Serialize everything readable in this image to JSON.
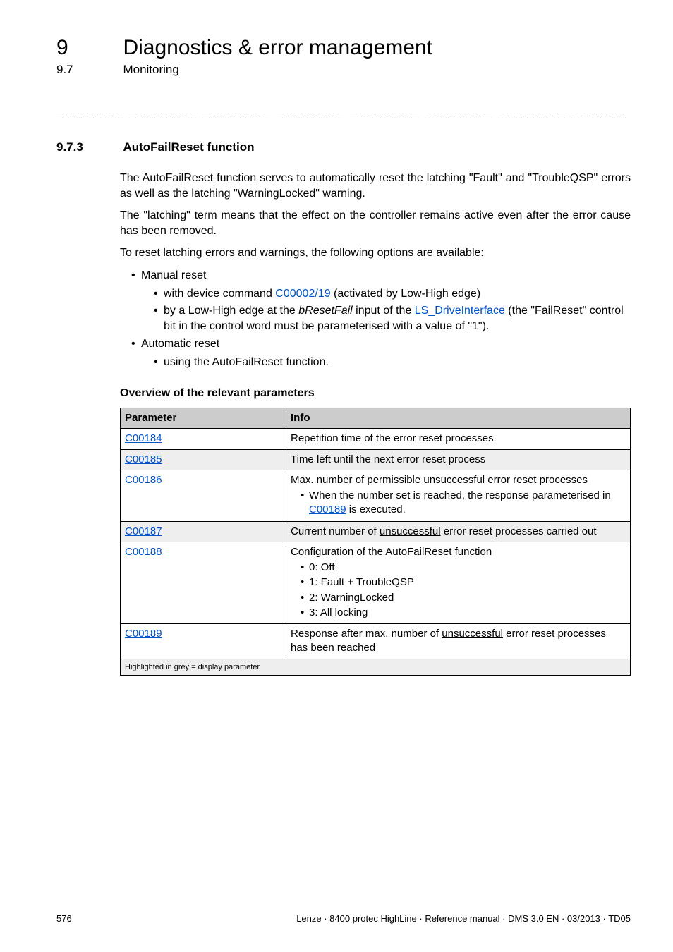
{
  "header": {
    "chapter_num": "9",
    "chapter_title": "Diagnostics & error management",
    "sub_num": "9.7",
    "sub_title": "Monitoring"
  },
  "dash_line": "_ _ _ _ _ _ _ _ _ _ _ _ _ _ _ _ _ _ _ _ _ _ _ _ _ _ _ _ _ _ _ _ _ _ _ _ _ _ _ _ _ _ _ _ _ _ _ _ _ _ _ _ _ _ _ _ _ _ _ _ _ _ _ _",
  "section": {
    "num": "9.7.3",
    "title": "AutoFailReset function"
  },
  "paras": {
    "p1": "The AutoFailReset function serves to automatically reset the latching \"Fault\" and \"TroubleQSP\" errors as well as the latching \"WarningLocked\" warning.",
    "p2": "The \"latching\" term means that the effect on the controller remains active even after the error cause has been removed.",
    "p3": "To reset latching errors and warnings, the following options are available:"
  },
  "list": {
    "i1": "Manual reset",
    "i1a_pre": "with device command ",
    "i1a_link": "C00002/19",
    "i1a_post": " (activated by Low-High edge)",
    "i1b_pre": "by a Low-High edge at the ",
    "i1b_it": "bResetFail",
    "i1b_mid": " input of the ",
    "i1b_link": "LS_DriveInterface",
    "i1b_post": " (the \"FailReset\" control bit in the control word must be parameterised with a value of \"1\").",
    "i2": "Automatic reset",
    "i2a": "using the AutoFailReset function."
  },
  "subhead": "Overview of the relevant parameters",
  "table": {
    "h1": "Parameter",
    "h2": "Info",
    "r1_p": "C00184",
    "r1_i": "Repetition time of the error reset processes",
    "r2_p": "C00185",
    "r2_i": "Time left until the next error reset process",
    "r3_p": "C00186",
    "r3_i_pre": "Max. number of permissible ",
    "r3_i_u": "unsuccessful",
    "r3_i_post": " error reset processes",
    "r3_b1_pre": "When the number set is reached, the response parameterised in ",
    "r3_b1_link": "C00189",
    "r3_b1_post": " is executed.",
    "r4_p": "C00187",
    "r4_i_pre": "Current number of ",
    "r4_i_u": "unsuccessful",
    "r4_i_post": " error reset processes carried out",
    "r5_p": "C00188",
    "r5_i": "Configuration of the AutoFailReset function",
    "r5_b1": "0: Off",
    "r5_b2": "1: Fault + TroubleQSP",
    "r5_b3": "2: WarningLocked",
    "r5_b4": "3: All locking",
    "r6_p": "C00189",
    "r6_i_pre": "Response after max. number of ",
    "r6_i_u": "unsuccessful",
    "r6_i_post": " error reset processes has been reached",
    "foot": "Highlighted in grey = display parameter"
  },
  "footer": {
    "page": "576",
    "meta": "Lenze · 8400 protec HighLine · Reference manual · DMS 3.0 EN · 03/2013 · TD05"
  }
}
